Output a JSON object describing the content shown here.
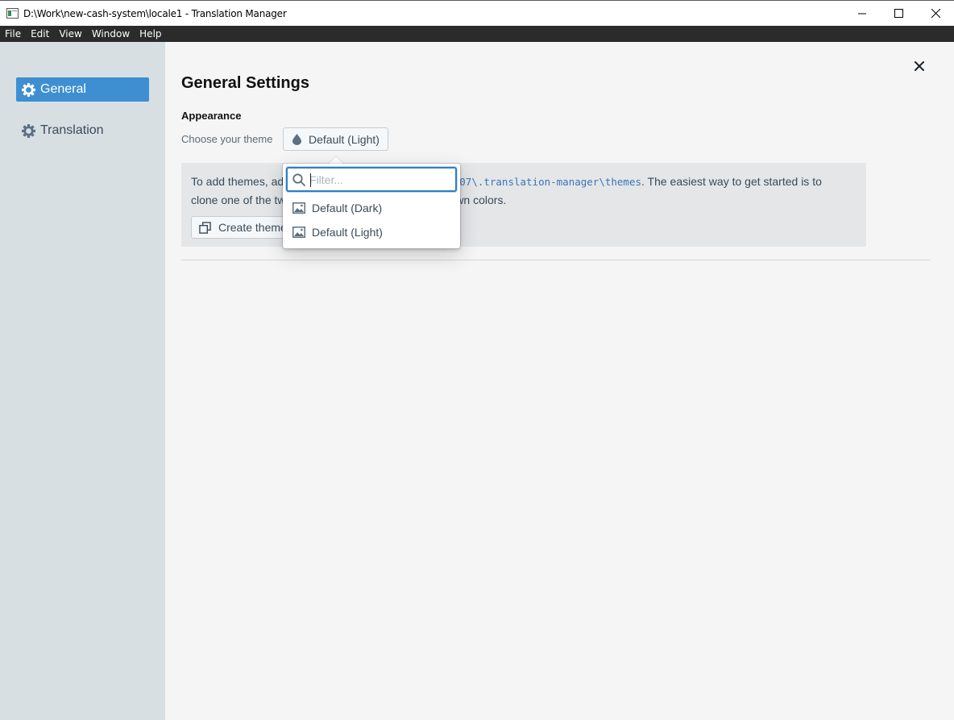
{
  "window": {
    "title": "D:\\Work\\new-cash-system\\locale1 - Translation Manager"
  },
  "menu": [
    "File",
    "Edit",
    "View",
    "Window",
    "Help"
  ],
  "sidebar": {
    "items": [
      {
        "label": "General",
        "icon": "gear-icon",
        "active": true
      },
      {
        "label": "Translation",
        "icon": "gear-icon",
        "active": false
      }
    ]
  },
  "main": {
    "title": "General Settings",
    "appearance": {
      "heading": "Appearance",
      "theme_label": "Choose your theme",
      "theme_value": "Default (Light)"
    },
    "info": {
      "text_start": "To add themes, ad",
      "path": "GP07\\.translation-manager\\themes",
      "text_after_path": ". The easiest way to get started is to",
      "line2_start": "clone one of the tw",
      "line2_end": "own colors.",
      "create_button": "Create theme"
    }
  },
  "popover": {
    "filter_placeholder": "Filter...",
    "options": [
      "Default (Dark)",
      "Default (Light)"
    ]
  },
  "colors": {
    "accent": "#3d8fd1",
    "sidebar": "#d8dfe3",
    "menubar": "#2b2b2b",
    "focus": "#2d7fc1"
  }
}
